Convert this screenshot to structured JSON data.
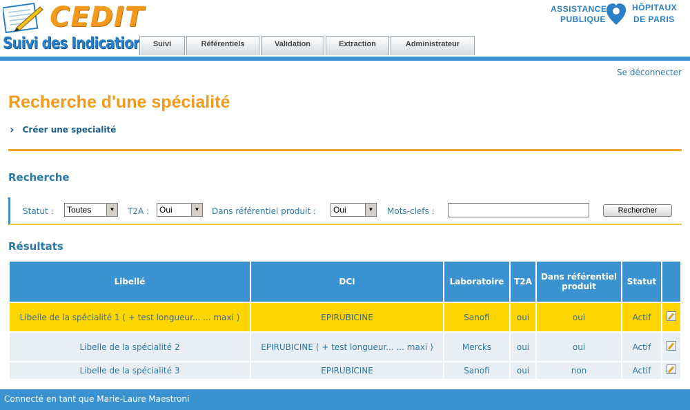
{
  "brand": {
    "logo_text": "CEDIT",
    "logo_subtitle": "Suivi des Indications",
    "aphp_line1a": "ASSISTANCE",
    "aphp_line1b": "HÔPITAUX",
    "aphp_line2a": "PUBLIQUE",
    "aphp_line2b": "DE PARIS"
  },
  "tabs": [
    {
      "label": "Suivi"
    },
    {
      "label": "Référentiels"
    },
    {
      "label": "Validation"
    },
    {
      "label": "Extraction"
    },
    {
      "label": "Administrateur"
    }
  ],
  "header": {
    "logout": "Se déconnecter"
  },
  "page": {
    "title": "Recherche d'une spécialité",
    "create_link": "Créer une specialité"
  },
  "search": {
    "title": "Recherche",
    "statut_label": "Statut :",
    "statut_value": "Toutes",
    "t2a_label": "T2A :",
    "t2a_value": "Oui",
    "ref_label": "Dans référentiel produit :",
    "ref_value": "Oui",
    "keywords_label": "Mots-clefs :",
    "keywords_value": "",
    "button": "Rechercher"
  },
  "results": {
    "title": "Résultats",
    "headers": [
      "Libellé",
      "DCI",
      "Laboratoire",
      "T2A",
      "Dans référentiel produit",
      "Statut",
      ""
    ],
    "rows": [
      {
        "libelle": "Libelle de la spécialité 1 ( + test longueur... ... maxi )",
        "dci": "EPIRUBICINE",
        "labo": "Sanofi",
        "t2a": "oui",
        "ref": "oui",
        "statut": "Actif"
      },
      {
        "libelle": "Libelle de la spécialité 2",
        "dci": "EPIRUBICINE ( + test longueur... ... maxi )",
        "labo": "Mercks",
        "t2a": "oui",
        "ref": "oui",
        "statut": "Actif"
      },
      {
        "libelle": "Libelle de la spécialité 3",
        "dci": "EPIRUBICINE",
        "labo": "Sanofi",
        "t2a": "oui",
        "ref": "non",
        "statut": "Actif"
      }
    ]
  },
  "footer": {
    "connected_as": "Connecté en tant que Marie-Laure Maestroni"
  },
  "colors": {
    "accent_blue": "#3a92d0",
    "orange": "#f39a1e",
    "highlight_yellow": "#ffd600"
  }
}
